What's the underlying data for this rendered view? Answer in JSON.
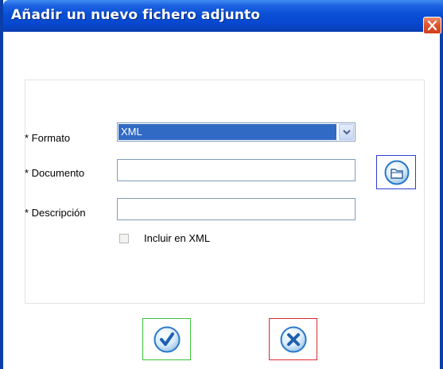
{
  "window": {
    "title": "Añadir un nuevo fichero adjunto",
    "close_icon": "close-icon"
  },
  "form": {
    "format_label": "* Formato",
    "format_value": "XML",
    "document_label": "* Documento",
    "document_value": "",
    "description_label": "* Descripción",
    "description_value": "",
    "include_xml_label": "Incluir en XML",
    "include_xml_checked": false,
    "browse_icon": "folder-icon"
  },
  "actions": {
    "accept_icon": "checkmark-icon",
    "cancel_icon": "x-icon"
  },
  "colors": {
    "titlebar": "#0a4fd6",
    "frame": "#0a3ea9",
    "selection": "#316ac5",
    "accept_border": "#3ac43a",
    "cancel_border": "#e0282c",
    "browse_border": "#2d3fd4",
    "icon_blue": "#2a78c8"
  }
}
